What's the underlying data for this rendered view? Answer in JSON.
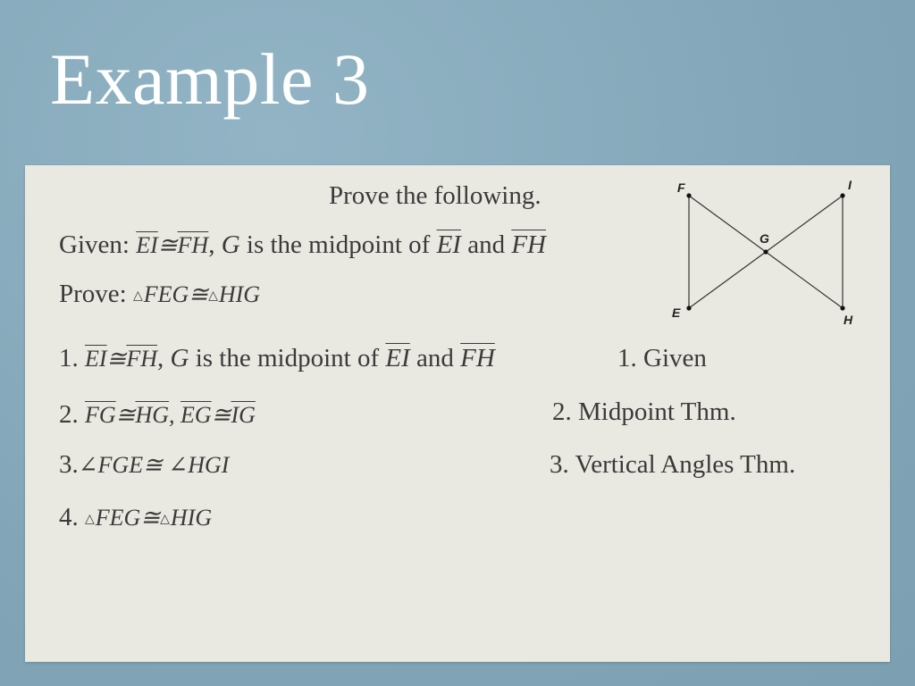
{
  "title": "Example 3",
  "header": "Prove the following.",
  "given": {
    "label": "Given:",
    "s1a": "EI",
    "cong": "≅",
    "s1b": "FH",
    "comma": ",",
    "point": "G",
    "text": " is the midpoint of ",
    "s2": "EI",
    "and": " and ",
    "s3": "FH"
  },
  "prove": {
    "label": "Prove:",
    "t1": "FEG",
    "cong": "≅",
    "t2": "HIG"
  },
  "steps": [
    {
      "num": "1.",
      "reason": "1. Given",
      "s1a": "EI",
      "cong": "≅",
      "s1b": "FH",
      "comma": ",",
      "point": "G",
      "text": " is the midpoint of ",
      "s2": "EI",
      "and": " and ",
      "s3": "FH"
    },
    {
      "num": "2.",
      "reason": "2. Midpoint Thm.",
      "a": "FG",
      "b": "HG",
      "sep": ",",
      "c": "EG",
      "d": "IG",
      "cong": "≅"
    },
    {
      "num": "3.",
      "reason": "3. Vertical Angles Thm.",
      "a": "FGE",
      "b": "HGI",
      "cong": "≅",
      "angle": "∠"
    },
    {
      "num": "4.",
      "reason": "",
      "a": "FEG",
      "b": "HIG",
      "cong": "≅",
      "tri": "△"
    }
  ],
  "diagram": {
    "labels": {
      "F": "F",
      "I": "I",
      "G": "G",
      "E": "E",
      "H": "H"
    }
  }
}
